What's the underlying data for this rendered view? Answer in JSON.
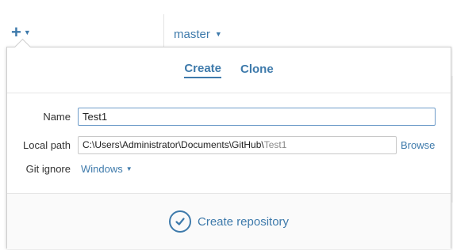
{
  "toolbar": {
    "add_icon": "plus-icon",
    "add_dropdown_icon": "caret-down-icon",
    "branch_label": "master",
    "branch_dropdown_icon": "caret-down-icon"
  },
  "popover": {
    "tabs": [
      {
        "label": "Create",
        "active": true
      },
      {
        "label": "Clone",
        "active": false
      }
    ],
    "form": {
      "name_label": "Name",
      "name_value": "Test1",
      "path_label": "Local path",
      "path_prefix": "C:\\Users\\Administrator\\Documents\\GitHub\\",
      "path_suffix": "Test1",
      "browse_label": "Browse",
      "ignore_label": "Git ignore",
      "ignore_value": "Windows"
    },
    "action": {
      "icon": "checkmark-circle-icon",
      "label": "Create repository"
    }
  },
  "colors": {
    "accent": "#3e7aab",
    "input_focus_border": "#6e9cc9",
    "input_border": "#c8c8c8",
    "footer_bg": "#fafafa"
  }
}
